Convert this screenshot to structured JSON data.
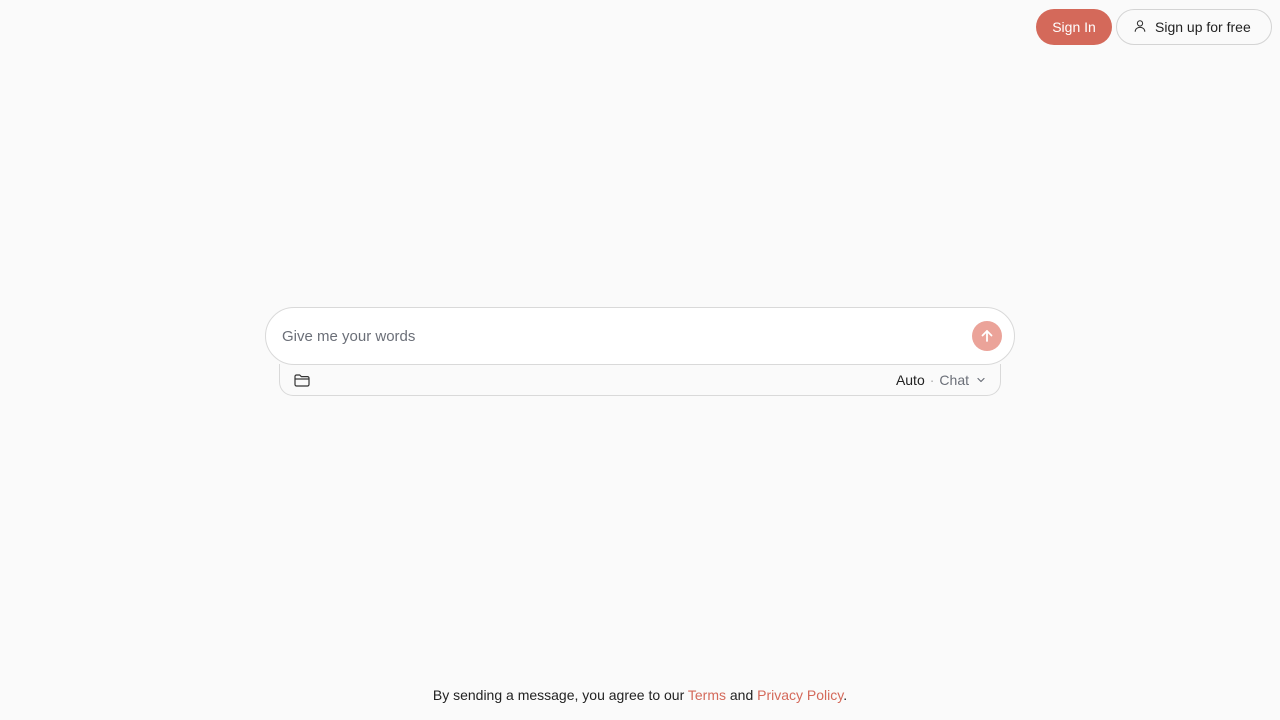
{
  "header": {
    "sign_in_label": "Sign In",
    "sign_up_label": "Sign up for free"
  },
  "composer": {
    "placeholder": "Give me your words",
    "mode_primary": "Auto",
    "mode_separator": "·",
    "mode_secondary": "Chat"
  },
  "footer": {
    "prefix": "By sending a message, you agree to our ",
    "terms_label": "Terms",
    "conjunction": " and ",
    "privacy_label": "Privacy Policy",
    "suffix": "."
  },
  "icons": {
    "signup": "user-icon",
    "send": "arrow-up-icon",
    "attach": "folder-icon",
    "dropdown": "chevron-down-icon"
  },
  "colors": {
    "accent": "#d4695a",
    "send_button": "#eba399",
    "background": "#fafafa"
  }
}
